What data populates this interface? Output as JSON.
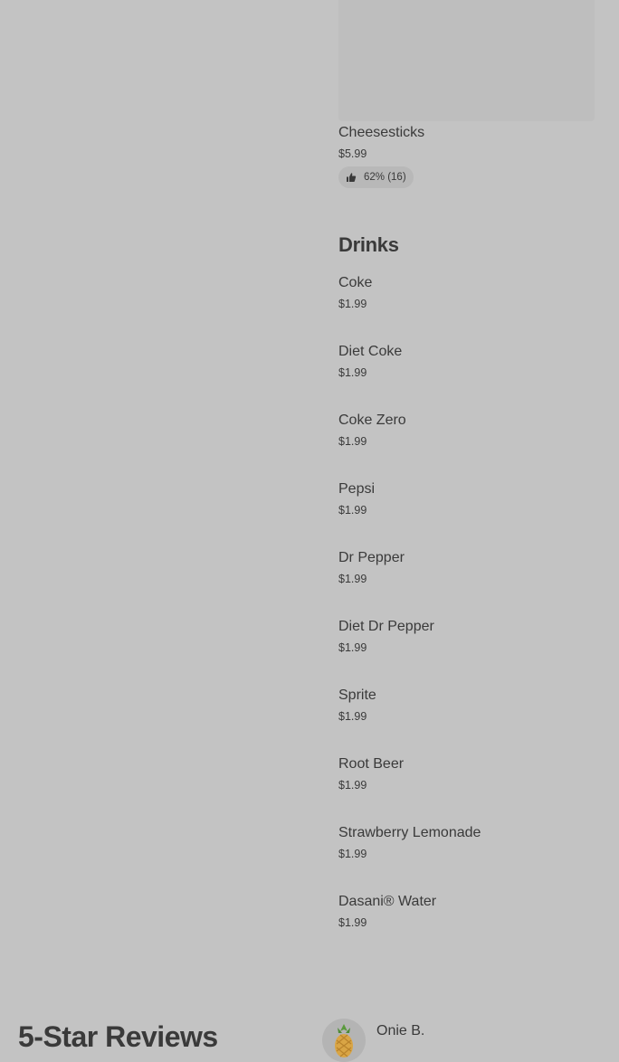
{
  "featured_item": {
    "name": "Cheesesticks",
    "price": "$5.99",
    "rating": "62% (16)"
  },
  "drinks_section": {
    "title": "Drinks",
    "items": [
      {
        "name": "Coke",
        "price": "$1.99"
      },
      {
        "name": "Diet Coke",
        "price": "$1.99"
      },
      {
        "name": "Coke Zero",
        "price": "$1.99"
      },
      {
        "name": "Pepsi",
        "price": "$1.99"
      },
      {
        "name": "Dr Pepper",
        "price": "$1.99"
      },
      {
        "name": "Diet Dr Pepper",
        "price": "$1.99"
      },
      {
        "name": "Sprite",
        "price": "$1.99"
      },
      {
        "name": "Root Beer",
        "price": "$1.99"
      },
      {
        "name": "Strawberry Lemonade",
        "price": "$1.99"
      },
      {
        "name": "Dasani® Water",
        "price": "$1.99"
      }
    ]
  },
  "reviews": {
    "title": "5-Star Reviews",
    "first_reviewer": "Onie B."
  },
  "icons": {
    "rating": "thumbs-up-icon",
    "avatar": "pineapple-avatar-icon"
  }
}
